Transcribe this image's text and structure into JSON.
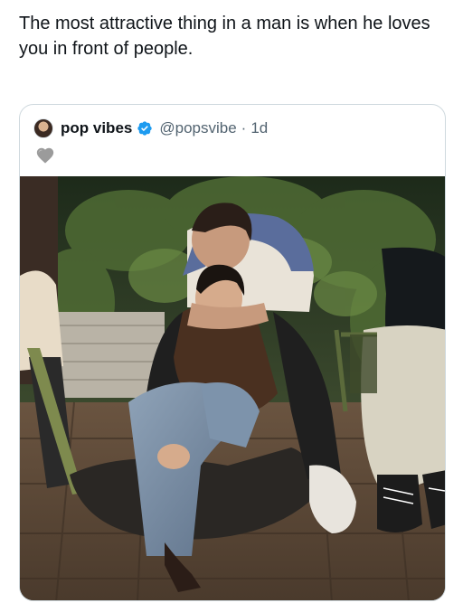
{
  "post": {
    "text": "The most attractive thing in a man is when he loves you in front of people."
  },
  "quote": {
    "author": {
      "display_name": "pop vibes",
      "handle": "@popsvibe",
      "verified": true,
      "separator": "·",
      "time": "1d"
    },
    "emoji": "grey-heart-icon",
    "media": {
      "kind": "photo",
      "icon": "photo-image"
    }
  },
  "colors": {
    "text_primary": "#0f1419",
    "text_secondary": "#536471",
    "verified_blue": "#1d9bf0",
    "card_border": "#cfd9de"
  }
}
